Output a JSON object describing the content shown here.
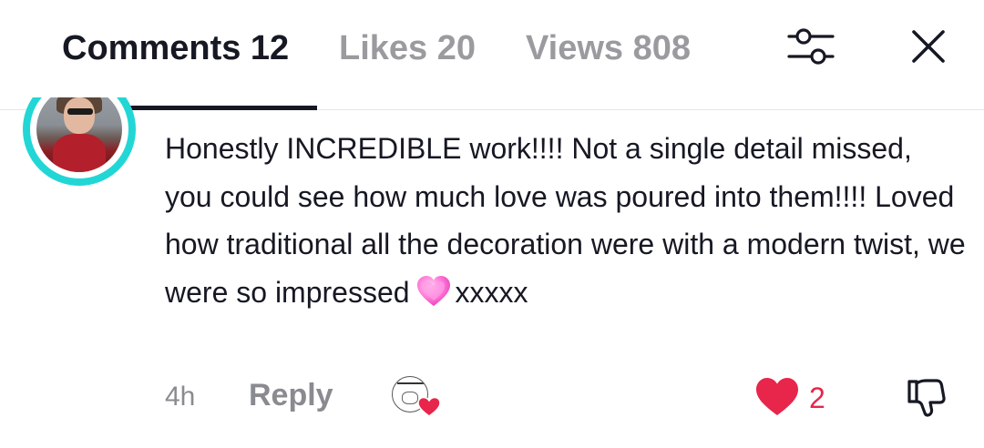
{
  "tabs": [
    {
      "label": "Comments 12",
      "active": true
    },
    {
      "label": "Likes 20",
      "active": false
    },
    {
      "label": "Views 808",
      "active": false
    }
  ],
  "icons": {
    "filter": "sliders-icon",
    "close": "close-icon",
    "like": "heart-filled-icon",
    "dislike": "thumbs-down-icon",
    "emoji": "pink-heart-emoji"
  },
  "colors": {
    "accent_ring": "#22d6d6",
    "like_red": "#e8254a",
    "muted": "#8a8b91",
    "text": "#161823"
  },
  "comment": {
    "text_before_emoji": "Honestly INCREDIBLE work!!!! Not a single detail missed, you could see how much love was poured into them!!!! Loved how traditional all the decoration were with a modern twist, we were so impressed",
    "text_after_emoji": "xxxxx",
    "time": "4h",
    "reply_label": "Reply",
    "like_count": "2",
    "liked_by_creator": true
  }
}
